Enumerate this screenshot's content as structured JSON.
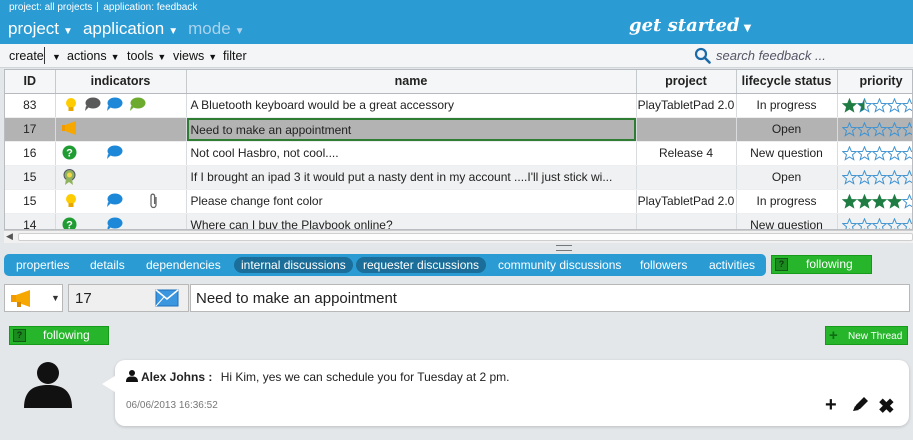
{
  "breadcrumb": {
    "project": "project: all projects",
    "application": "application: feedback"
  },
  "menus": {
    "project": "project",
    "application": "application",
    "mode": "mode",
    "get_started": "get started"
  },
  "toolbar": {
    "create": "create",
    "actions": "actions",
    "tools": "tools",
    "views": "views",
    "filter": "filter",
    "search_placeholder": "search feedback ..."
  },
  "grid": {
    "columns": {
      "id": "ID",
      "indicators": "indicators",
      "name": "name",
      "project": "project",
      "lifecycle": "lifecycle status",
      "priority": "priority"
    },
    "rows": [
      {
        "id": "83",
        "name": "A Bluetooth keyboard would be a great accessory",
        "project": "PlayTabletPad 2.0",
        "status": "In progress",
        "rating": 1.5,
        "indicators": [
          "bulb-icon",
          "chat-bubble-gray-icon",
          "chat-bubble-blue-icon",
          "chat-bubble-green-icon"
        ]
      },
      {
        "id": "17",
        "name": "Need to make an appointment",
        "project": "",
        "status": "Open",
        "rating": 0,
        "indicators": [
          "megaphone-icon"
        ]
      },
      {
        "id": "16",
        "name": "Not cool Hasbro, not cool....",
        "project": "Release 4",
        "status": "New question",
        "rating": 0,
        "indicators": [
          "question-icon",
          "chat-bubble-blue-icon"
        ]
      },
      {
        "id": "15",
        "name": "If I brought an ipad 3 it would put a nasty dent in my account ....I'll just stick wi...",
        "project": "",
        "status": "Open",
        "rating": 0,
        "indicators": [
          "ribbon-icon"
        ]
      },
      {
        "id": "15",
        "name": "Please change font color",
        "project": "PlayTabletPad 2.0",
        "status": "In progress",
        "rating": 4,
        "indicators": [
          "bulb-icon",
          "chat-bubble-blue-icon",
          "paperclip-icon"
        ]
      },
      {
        "id": "14",
        "name": "Where can I buy the Playbook online?",
        "project": "",
        "status": "New question",
        "rating": 0,
        "indicators": [
          "question-icon",
          "chat-bubble-blue-icon"
        ]
      }
    ]
  },
  "tabs": [
    "properties",
    "details",
    "dependencies",
    "internal discussions",
    "requester discussions",
    "community discussions",
    "followers",
    "activities"
  ],
  "active_tabs": [
    "internal discussions",
    "requester discussions"
  ],
  "following_label": "following",
  "detail": {
    "id": "17",
    "title": "Need to make an appointment"
  },
  "new_thread_label": "New Thread",
  "comment": {
    "author": "Alex Johns :",
    "text": "Hi Kim, yes we can schedule you for Tuesday at 2 pm.",
    "timestamp": "06/06/2013 16:36:52"
  },
  "colors": {
    "header_blue": "#2b9bd3",
    "tab_active": "#1a6e99",
    "green_button": "#26b52b",
    "selected_row": "#b3b3b3",
    "star_fill": "#1f7d44",
    "star_outline": "#3f93d1"
  }
}
